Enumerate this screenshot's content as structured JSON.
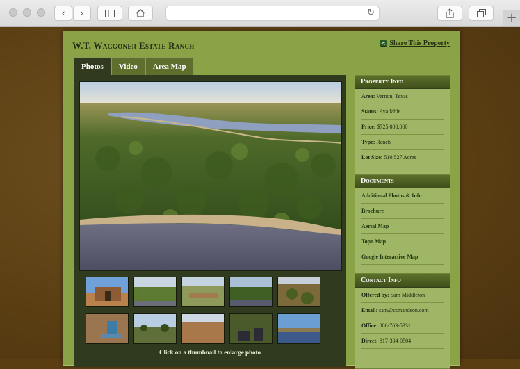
{
  "browser": {
    "back_icon": "chevron-left-icon",
    "forward_icon": "chevron-right-icon",
    "sidebar_icon": "sidebar-icon",
    "home_icon": "home-icon",
    "reload_icon": "reload-icon",
    "share_icon": "share-icon",
    "tabs_icon": "tabs-icon",
    "new_tab_icon": "plus-icon"
  },
  "page": {
    "title": "W.T. Waggoner Estate Ranch",
    "share_label": "Share This Property",
    "tabs": [
      {
        "label": "Photos",
        "active": true
      },
      {
        "label": "Video",
        "active": false
      },
      {
        "label": "Area Map",
        "active": false
      }
    ],
    "caption": "Click on a thumbnail to enlarge photo"
  },
  "property_info": {
    "heading": "Property Info",
    "rows": [
      {
        "label": "Area:",
        "value": "Vernon, Texas"
      },
      {
        "label": "Status:",
        "value": "Available"
      },
      {
        "label": "Price:",
        "value": "$725,000,000"
      },
      {
        "label": "Type:",
        "value": "Ranch"
      },
      {
        "label": "Lot Size:",
        "value": "510,527 Acres"
      }
    ]
  },
  "documents": {
    "heading": "Documents",
    "links": [
      "Additional Photos & Info",
      "Brochure",
      "Aerial Map",
      "Topo Map",
      "Google Interactive Map"
    ]
  },
  "contact": {
    "heading": "Contact Info",
    "rows": [
      {
        "label": "Offered by:",
        "value": "Sam Middleton"
      },
      {
        "label": "Email:",
        "value": "sam@csmandson.com"
      },
      {
        "label": "Office:",
        "value": "806-763-5331"
      },
      {
        "label": "Direct:",
        "value": "817-304-0504"
      }
    ]
  }
}
